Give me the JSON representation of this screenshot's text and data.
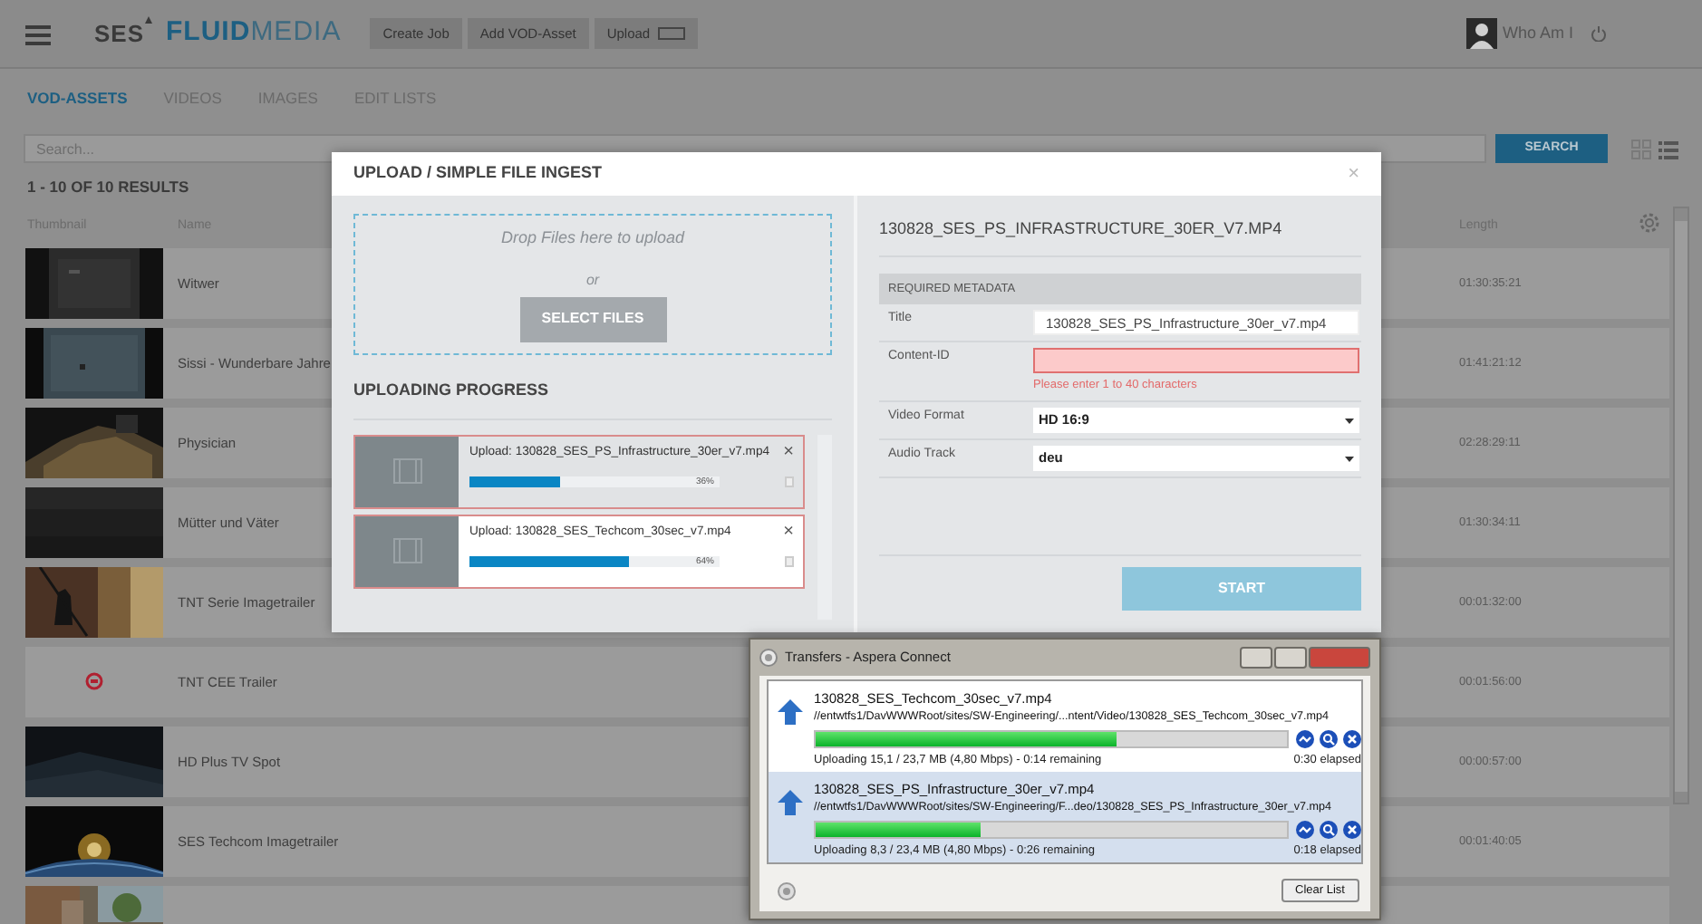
{
  "app_bar": {
    "brand_prefix": "SES",
    "brand_name": "FLUID",
    "brand_suffix": "MEDIA",
    "buttons": [
      {
        "label": "Create Job",
        "kind": "plain"
      },
      {
        "label": "Add VOD-Asset",
        "kind": "plain"
      },
      {
        "label": "Upload",
        "kind": "with-icon"
      }
    ],
    "user": "Who Am I"
  },
  "tabs": [
    {
      "label": "VOD-ASSETS",
      "selected": true
    },
    {
      "label": "VIDEOS",
      "selected": false
    },
    {
      "label": "IMAGES",
      "selected": false
    },
    {
      "label": "EDIT LISTS",
      "selected": false
    }
  ],
  "search": {
    "placeholder": "Search...",
    "button": "SEARCH"
  },
  "results": "1 - 10 OF 10 RESULTS",
  "table": {
    "columns": [
      "Thumbnail",
      "Name",
      "Length"
    ],
    "rows": [
      {
        "kind": "picture",
        "name": "Witwer",
        "length": "01:30:35:21"
      },
      {
        "kind": "picture",
        "name": "Sissi - Wunderbare Jahre",
        "length": "01:41:21:12"
      },
      {
        "kind": "picture",
        "name": "Physician",
        "length": "02:28:29:11"
      },
      {
        "kind": "picture",
        "name": "Mütter und Väter",
        "length": "01:30:34:11"
      },
      {
        "kind": "picture",
        "name": "TNT Serie Imagetrailer",
        "length": "00:01:32:00"
      },
      {
        "kind": "logo",
        "name": "TNT CEE Trailer",
        "length": "00:01:56:00"
      },
      {
        "kind": "picture",
        "name": "HD Plus TV Spot",
        "length": "00:00:57:00"
      },
      {
        "kind": "picture",
        "name": "SES Techcom Imagetrailer",
        "length": "00:01:40:05"
      },
      {
        "kind": "picture"
      }
    ]
  },
  "upload_dialog": {
    "title": "UPLOAD / SIMPLE FILE INGEST",
    "close": "×",
    "dropzone": {
      "hint": "Drop Files here to upload",
      "or": "or",
      "button": "SELECT FILES"
    },
    "progress_heading": "UPLOADING PROGRESS",
    "uploads": [
      {
        "label": "Upload: 130828_SES_PS_Infrastructure_30er_v7.mp4",
        "level": 0.36,
        "percent": "36%",
        "remove": "×",
        "selected": true
      },
      {
        "label": "Upload: 130828_SES_Techcom_30sec_v7.mp4",
        "level": 0.64,
        "percent": "64%",
        "remove": "×",
        "selected": false
      }
    ],
    "file_heading": "130828_SES_PS_INFRASTRUCTURE_30ER_V7.MP4",
    "metadata_heading": "REQUIRED METADATA",
    "fields": [
      {
        "label": "Title",
        "kind": "text",
        "value": "130828_SES_PS_Infrastructure_30er_v7.mp4",
        "invalid": false
      },
      {
        "label": "Content-ID",
        "kind": "text",
        "invalid": true,
        "error": "Please enter 1 to 40 characters"
      },
      {
        "label": "Video Format",
        "kind": "select",
        "value": "HD 16:9",
        "invalid": false
      },
      {
        "label": "Audio Track",
        "kind": "select",
        "value": "deu",
        "invalid": false
      }
    ],
    "start_button": {
      "label": "START",
      "disabled": true
    }
  },
  "transfers_window": {
    "title": "Transfers - Aspera Connect",
    "transfers": [
      {
        "name": "130828_SES_Techcom_30sec_v7.mp4",
        "path": "//entwtfs1/DavWWWRoot/sites/SW-Engineering/...ntent/Video/130828_SES_Techcom_30sec_v7.mp4",
        "level": 0.64,
        "status": "Uploading 15,1 / 23,7 MB (4,80 Mbps) - 0:14 remaining",
        "elapsed": "0:30 elapsed",
        "selected": false
      },
      {
        "name": "130828_SES_PS_Infrastructure_30er_v7.mp4",
        "path": "//entwtfs1/DavWWWRoot/sites/SW-Engineering/F...deo/130828_SES_PS_Infrastructure_30er_v7.mp4",
        "level": 0.35,
        "status": "Uploading 8,3 / 23,4 MB (4,80 Mbps) - 0:26 remaining",
        "elapsed": "0:18 elapsed",
        "selected": true
      }
    ],
    "clear_button": "Clear List"
  }
}
